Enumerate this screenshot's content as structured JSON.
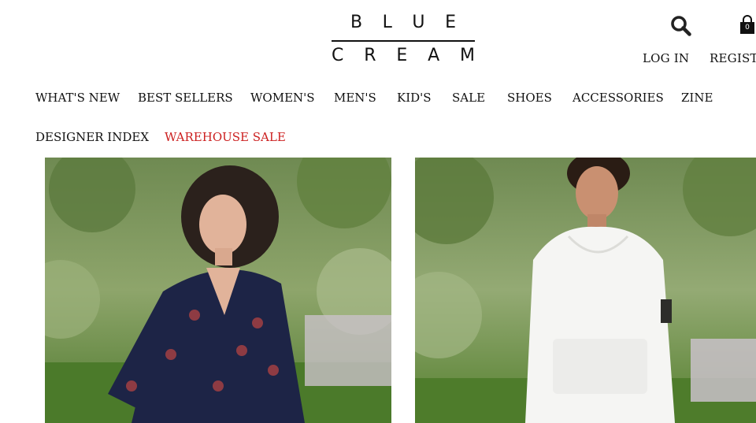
{
  "brand": {
    "line1": [
      "B",
      "L",
      "U",
      "E"
    ],
    "line2": [
      "C",
      "R",
      "E",
      "A",
      "M"
    ]
  },
  "header": {
    "search_icon": "search-icon",
    "cart_icon": "shopping-bag-icon",
    "cart_count": "0",
    "login_label": "LOG IN",
    "register_label": "REGISTER"
  },
  "nav": {
    "row1": [
      "WHAT'S NEW",
      "BEST SELLERS",
      "WOMEN'S",
      "MEN'S",
      "KID'S",
      "SALE",
      "SHOES",
      "ACCESSORIES",
      "ZINE"
    ],
    "row2": [
      "DESIGNER INDEX",
      "WAREHOUSE SALE"
    ]
  },
  "colors": {
    "accent_red": "#cc1f1f",
    "text": "#111111"
  },
  "hero": {
    "left_image": "women-model-photo",
    "right_image": "men-model-photo"
  }
}
